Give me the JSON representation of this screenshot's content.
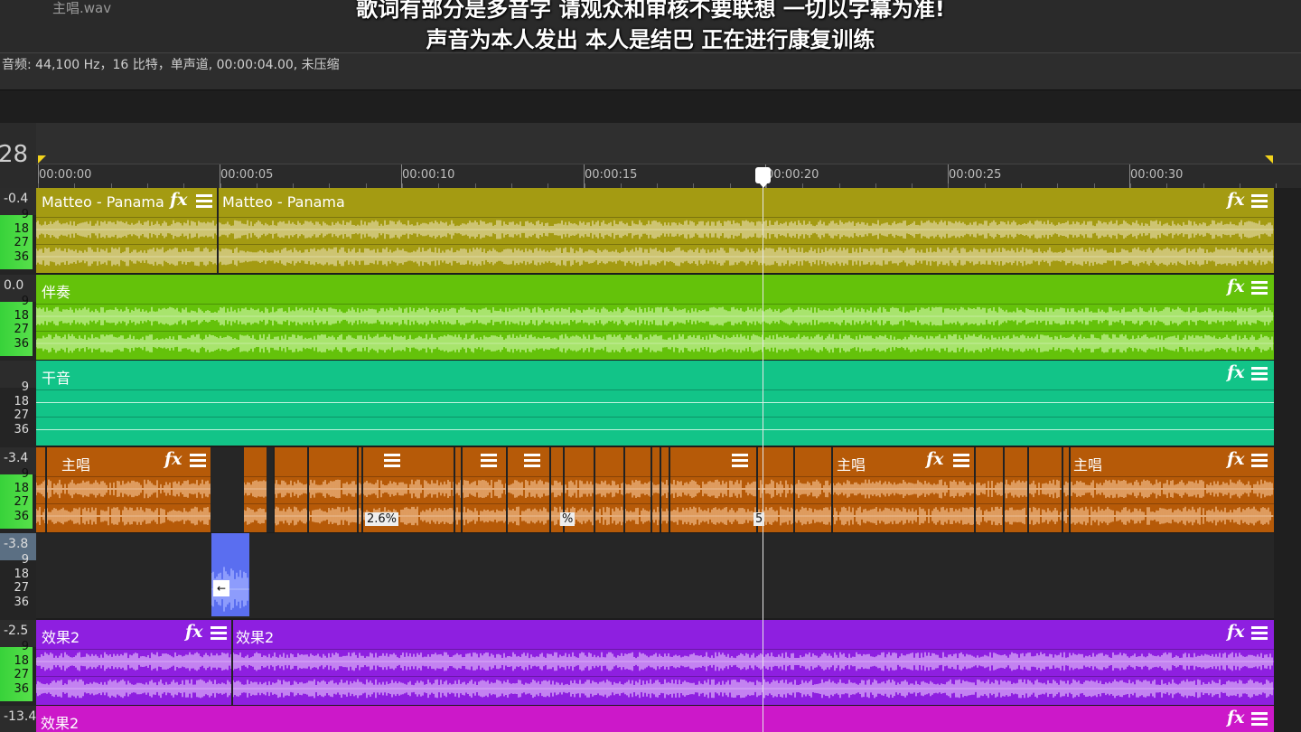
{
  "file_name": "主唱.wav",
  "subtitle_line1": "歌词有部分是多音字 请观众和审核不要联想 一切以字幕为准!",
  "subtitle_line2": "声音为本人发出 本人是结巴 正在进行康复训练",
  "audio_info": "音频: 44,100 Hz，16 比特，单声道, 00:00:04.00, 未压缩",
  "time_number": "28",
  "ruler": {
    "labels": [
      "00:00:00",
      "00:00:05",
      "00:00:10",
      "00:00:15",
      "00:00:20",
      "00:00:25",
      "00:00:30"
    ]
  },
  "meters": {
    "labels": [
      "9",
      "18",
      "27",
      "36"
    ],
    "heads": [
      "-0.4",
      "0.0",
      "",
      "-3.4",
      "-3.8",
      "-2.5",
      "-13.4"
    ]
  },
  "tracks": [
    {
      "name": "Matteo - Panama",
      "color": "#a49b12",
      "wave": "#d8cf8a"
    },
    {
      "name": "伴奏",
      "color": "#64c20a",
      "wave": "#b9ec86"
    },
    {
      "name": "干音",
      "color": "#12c488",
      "wave": "#7fe2c0"
    },
    {
      "name": "主唱",
      "color": "#b65a08",
      "wave": "#e9ac74"
    },
    {
      "name": "",
      "color": "#262626",
      "wave": "#5a6ef0"
    },
    {
      "name": "效果2",
      "color": "#8e1fe0",
      "wave": "#d19cf5"
    },
    {
      "name": "效果2",
      "color": "#cc18c9",
      "wave": "#e78be6"
    }
  ],
  "fx_label": "fx",
  "percent_labels": [
    "2.6%",
    "%",
    "5"
  ],
  "colors": {
    "playhead": "#e6e6e6",
    "loop_marker": "#f2d31c"
  }
}
